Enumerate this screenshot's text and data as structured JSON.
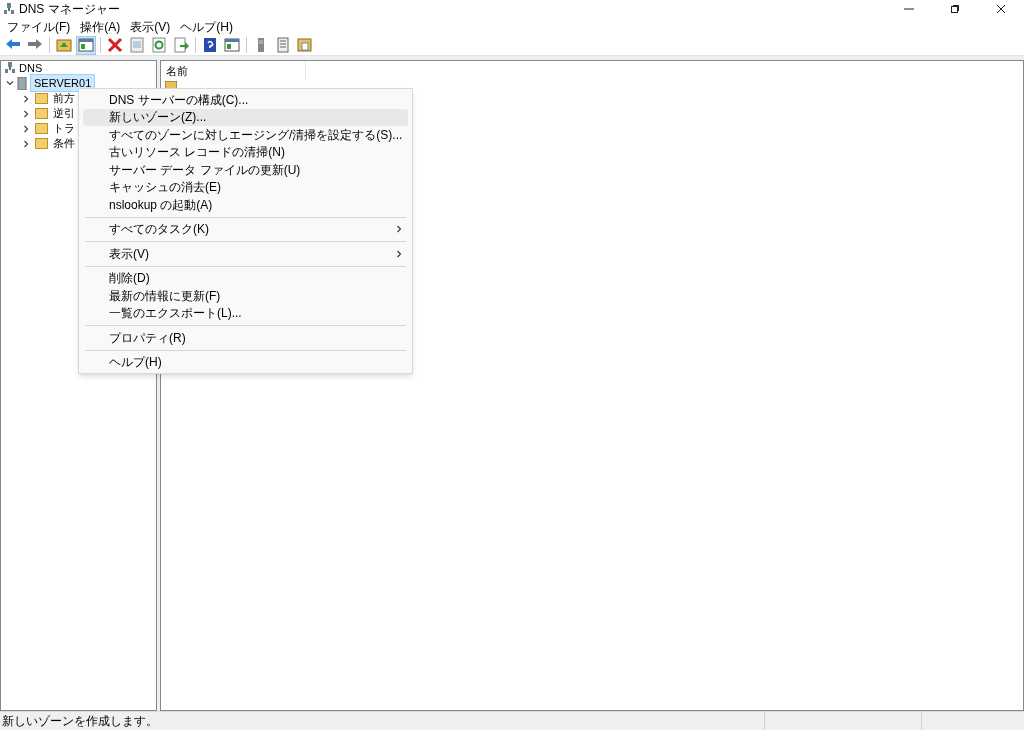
{
  "window": {
    "title": "DNS マネージャー"
  },
  "menu_bar": [
    "ファイル(F)",
    "操作(A)",
    "表示(V)",
    "ヘルプ(H)"
  ],
  "toolbar": [
    {
      "kind": "back"
    },
    {
      "kind": "forward"
    },
    {
      "kind": "sep"
    },
    {
      "kind": "up"
    },
    {
      "kind": "pane",
      "selected": true
    },
    {
      "kind": "sep"
    },
    {
      "kind": "delete"
    },
    {
      "kind": "props"
    },
    {
      "kind": "refresh"
    },
    {
      "kind": "export"
    },
    {
      "kind": "sep"
    },
    {
      "kind": "help"
    },
    {
      "kind": "pane",
      "selected": false
    },
    {
      "kind": "sep"
    },
    {
      "kind": "server"
    },
    {
      "kind": "list"
    },
    {
      "kind": "folder"
    }
  ],
  "tree": {
    "label": "DNS",
    "expanded": true,
    "children": [
      {
        "label": "SERVER01",
        "selected": true,
        "expanded": true,
        "children": [
          {
            "label": "前方",
            "expanded": false
          },
          {
            "label": "逆引",
            "expanded": false
          },
          {
            "label": "トラ",
            "expanded": false
          },
          {
            "label": "条件",
            "expanded": false
          }
        ]
      }
    ]
  },
  "list": {
    "columns": [
      "名前"
    ]
  },
  "context_menu": [
    {
      "kind": "item",
      "label": "DNS サーバーの構成(C)...",
      "selected": false
    },
    {
      "kind": "item",
      "label": "新しいゾーン(Z)...",
      "selected": true
    },
    {
      "kind": "item",
      "label": "すべてのゾーンに対しエージング/清掃を設定する(S)...",
      "selected": false
    },
    {
      "kind": "item",
      "label": "古いリソース レコードの清掃(N)",
      "selected": false
    },
    {
      "kind": "item",
      "label": "サーバー データ ファイルの更新(U)",
      "selected": false
    },
    {
      "kind": "item",
      "label": "キャッシュの消去(E)",
      "selected": false
    },
    {
      "kind": "item",
      "label": "nslookup の起動(A)",
      "selected": false
    },
    {
      "kind": "separator"
    },
    {
      "kind": "submenu",
      "label": "すべてのタスク(K)",
      "selected": false
    },
    {
      "kind": "separator"
    },
    {
      "kind": "submenu",
      "label": "表示(V)",
      "selected": false
    },
    {
      "kind": "separator"
    },
    {
      "kind": "item",
      "label": "削除(D)",
      "selected": false
    },
    {
      "kind": "item",
      "label": "最新の情報に更新(F)",
      "selected": false
    },
    {
      "kind": "item",
      "label": "一覧のエクスポート(L)...",
      "selected": false
    },
    {
      "kind": "separator"
    },
    {
      "kind": "item",
      "label": "プロパティ(R)",
      "selected": false
    },
    {
      "kind": "separator"
    },
    {
      "kind": "item",
      "label": "ヘルプ(H)",
      "selected": false
    }
  ],
  "status_bar": {
    "text": "新しいゾーンを作成します。"
  }
}
